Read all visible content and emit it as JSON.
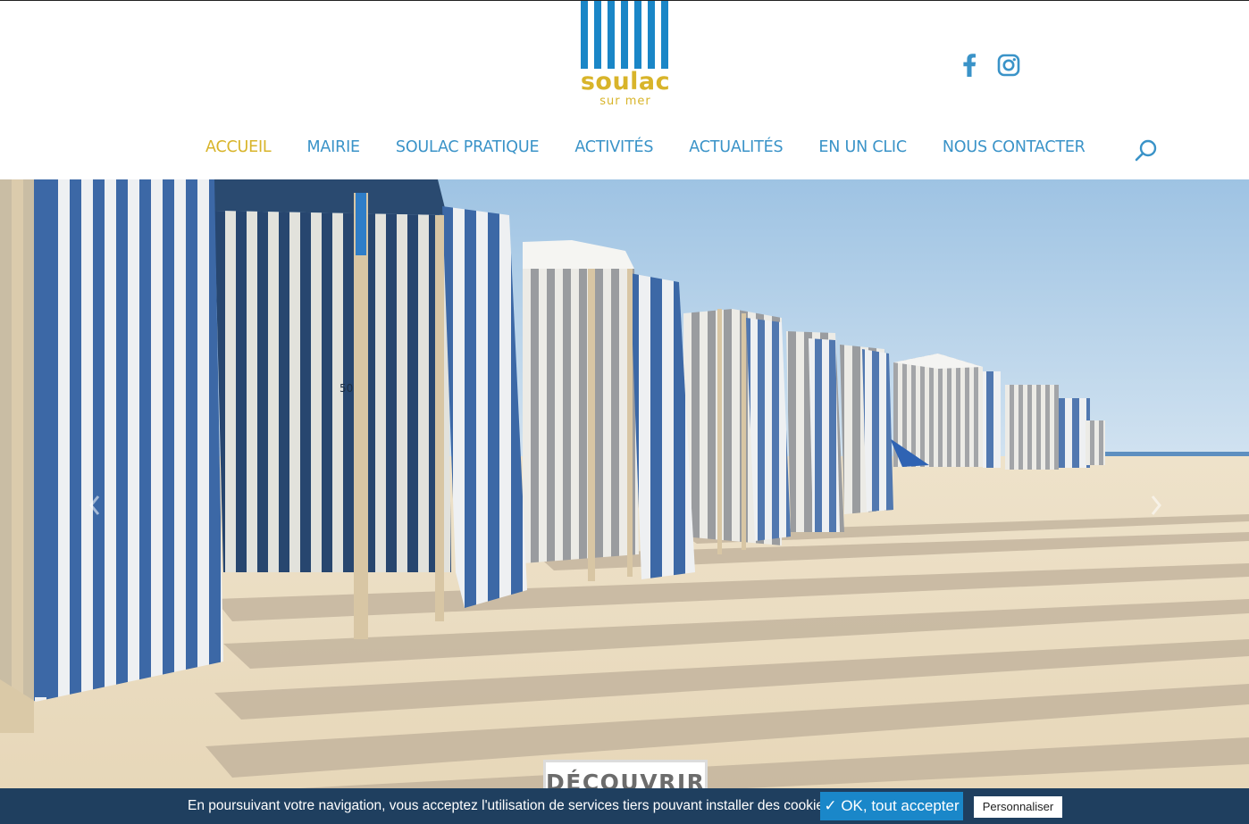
{
  "header": {
    "logo": {
      "word": "soulac",
      "sub": "sur mer",
      "color_blue": "#1a86c7",
      "color_gold": "#d8b42a"
    },
    "social": [
      {
        "name": "facebook-icon"
      },
      {
        "name": "instagram-icon"
      }
    ],
    "nav": [
      {
        "label": "ACCUEIL",
        "active": true
      },
      {
        "label": "MAIRIE"
      },
      {
        "label": "SOULAC PRATIQUE"
      },
      {
        "label": "ACTIVITÉS"
      },
      {
        "label": "ACTUALITÉS"
      },
      {
        "label": "EN UN CLIC"
      },
      {
        "label": "NOUS CONTACTER"
      }
    ],
    "search_icon": "search-icon"
  },
  "hero": {
    "image": "beach-tents-striped",
    "prev_icon": "chevron-left-icon",
    "next_icon": "chevron-right-icon",
    "cta_label": "DÉCOUVRIR"
  },
  "cookie_banner": {
    "text": "En poursuivant votre navigation, vous acceptez l'utilisation de services tiers pouvant installer des cookies",
    "accept_label": "✓ OK, tout accepter",
    "customize_label": "Personnaliser",
    "background": "#1f3f5f",
    "accept_color": "#1a87c9"
  }
}
